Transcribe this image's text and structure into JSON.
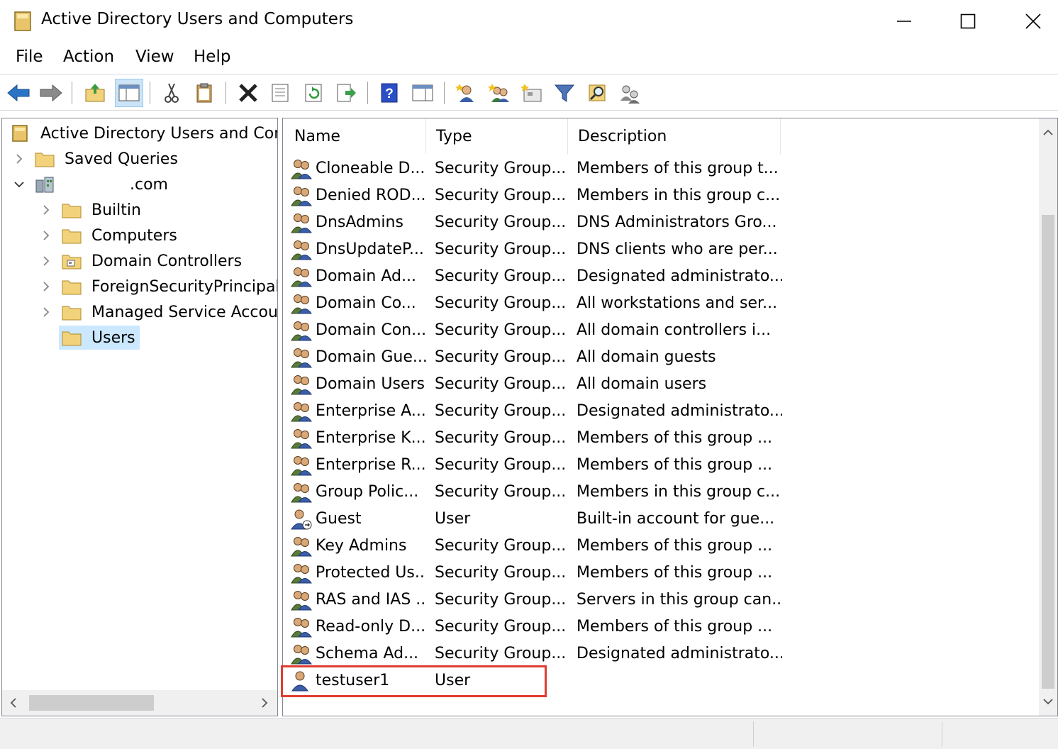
{
  "window": {
    "title": "Active Directory Users and Computers"
  },
  "menu": [
    "File",
    "Action",
    "View",
    "Help"
  ],
  "toolbar": {
    "buttons": [
      "back-icon",
      "forward-icon",
      "up-folder-icon",
      "show-hide-console-tree-icon",
      "cut-icon",
      "paste-icon",
      "delete-icon",
      "properties-icon",
      "refresh-icon",
      "export-list-icon",
      "help-icon",
      "show-hide-action-pane-icon",
      "new-user-icon",
      "new-group-icon",
      "new-ou-icon",
      "filter-icon",
      "find-icon",
      "delegate-control-icon"
    ]
  },
  "tree": {
    "root": "Active Directory Users and Com",
    "saved_queries": "Saved Queries",
    "domain": ".com",
    "children": [
      "Builtin",
      "Computers",
      "Domain Controllers",
      "ForeignSecurityPrincipals",
      "Managed Service Accounts",
      "Users"
    ],
    "selected": "Users"
  },
  "list": {
    "columns": [
      "Name",
      "Type",
      "Description"
    ],
    "rows": [
      {
        "name": "Cloneable D...",
        "type": "Security Group...",
        "description": "Members of this group t...",
        "kind": "group"
      },
      {
        "name": "Denied ROD...",
        "type": "Security Group...",
        "description": "Members in this group c...",
        "kind": "group"
      },
      {
        "name": "DnsAdmins",
        "type": "Security Group...",
        "description": "DNS Administrators Gro...",
        "kind": "group"
      },
      {
        "name": "DnsUpdateP...",
        "type": "Security Group...",
        "description": "DNS clients who are per...",
        "kind": "group"
      },
      {
        "name": "Domain Ad...",
        "type": "Security Group...",
        "description": "Designated administrato...",
        "kind": "group"
      },
      {
        "name": "Domain Co...",
        "type": "Security Group...",
        "description": "All workstations and ser...",
        "kind": "group"
      },
      {
        "name": "Domain Con...",
        "type": "Security Group...",
        "description": "All domain controllers i...",
        "kind": "group"
      },
      {
        "name": "Domain Gue...",
        "type": "Security Group...",
        "description": "All domain guests",
        "kind": "group"
      },
      {
        "name": "Domain Users",
        "type": "Security Group...",
        "description": "All domain users",
        "kind": "group"
      },
      {
        "name": "Enterprise A...",
        "type": "Security Group...",
        "description": "Designated administrato...",
        "kind": "group"
      },
      {
        "name": "Enterprise K...",
        "type": "Security Group...",
        "description": "Members of this group ...",
        "kind": "group"
      },
      {
        "name": "Enterprise R...",
        "type": "Security Group...",
        "description": "Members of this group ...",
        "kind": "group"
      },
      {
        "name": "Group Polic...",
        "type": "Security Group...",
        "description": "Members in this group c...",
        "kind": "group"
      },
      {
        "name": "Guest",
        "type": "User",
        "description": "Built-in account for gue...",
        "kind": "user-disabled"
      },
      {
        "name": "Key Admins",
        "type": "Security Group...",
        "description": "Members of this group ...",
        "kind": "group"
      },
      {
        "name": "Protected Us...",
        "type": "Security Group...",
        "description": "Members of this group ...",
        "kind": "group"
      },
      {
        "name": "RAS and IAS ...",
        "type": "Security Group...",
        "description": "Servers in this group can...",
        "kind": "group"
      },
      {
        "name": "Read-only D...",
        "type": "Security Group...",
        "description": "Members of this group ...",
        "kind": "group"
      },
      {
        "name": "Schema Ad...",
        "type": "Security Group...",
        "description": "Designated administrato...",
        "kind": "group"
      },
      {
        "name": "testuser1",
        "type": "User",
        "description": "",
        "kind": "user"
      }
    ]
  },
  "colors": {
    "highlight": "#e03c31",
    "selection": "#cce8ff",
    "accent": "#2b74c5"
  }
}
